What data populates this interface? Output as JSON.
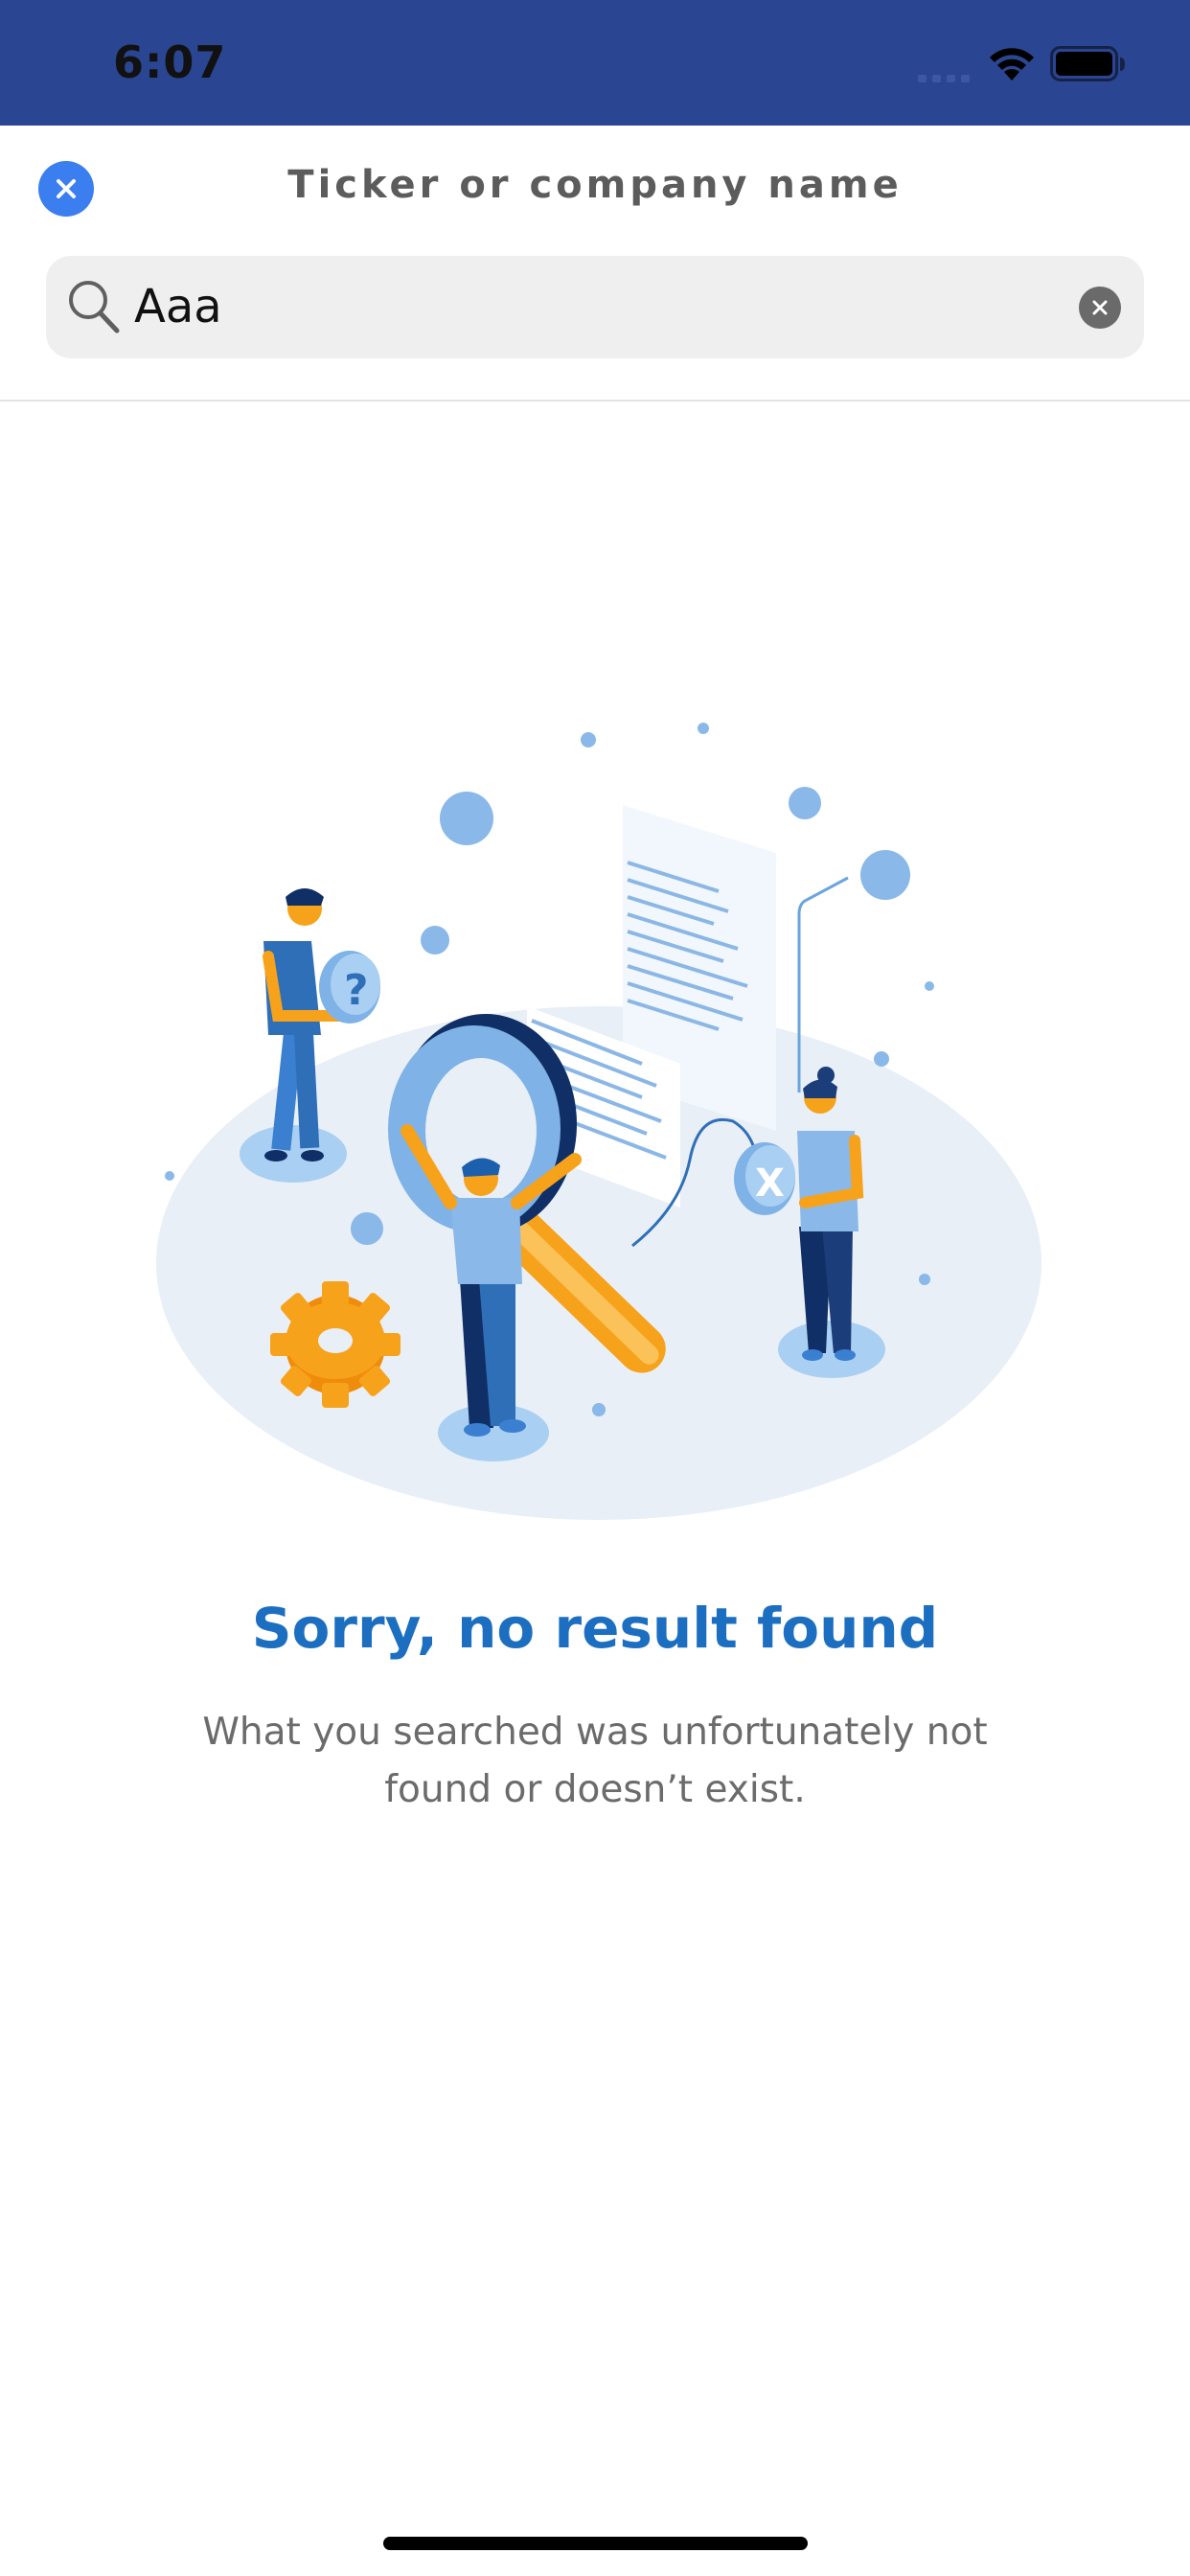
{
  "status_bar": {
    "time": "6:07"
  },
  "header": {
    "title": "Ticker or company name"
  },
  "search": {
    "value": "Aaa"
  },
  "empty_state": {
    "title": "Sorry, no result found",
    "message": "What you searched was unfortunately not found or doesn’t exist."
  },
  "colors": {
    "status_bar_bg": "#2a4591",
    "accent_blue": "#3a7ef0",
    "title_blue": "#1c6fc0",
    "illustration_orange": "#f7a21b"
  }
}
